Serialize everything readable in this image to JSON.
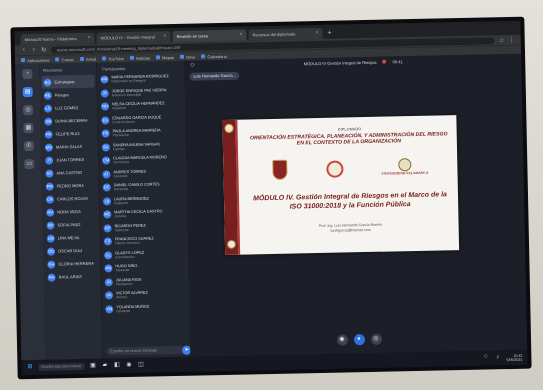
{
  "browser": {
    "tabs": [
      {
        "label": "Microsoft Teams - Plataforma"
      },
      {
        "label": "MÓDULO IV - Gestión Integral"
      },
      {
        "label": "Reunión en curso",
        "active": true
      },
      {
        "label": "Recursos del diplomado"
      }
    ],
    "new_tab": "+",
    "url": "teams.microsoft.com/_#/meeting/19:meeting_diplomado@thread.v2/0",
    "bookmarks": [
      "Aplicaciones",
      "Correo",
      "Gmail",
      "YouTube",
      "Noticias",
      "Mapas",
      "Drive",
      "Calendario"
    ]
  },
  "rail": {
    "icons": [
      "bell-icon",
      "chat-icon",
      "team-icon",
      "calendar-icon",
      "call-icon",
      "file-icon"
    ]
  },
  "chat_pane": {
    "header": "Reuniones",
    "items": [
      {
        "initials": "EG",
        "name": "Estrategias",
        "selected": true
      },
      {
        "initials": "RE",
        "name": "Riesgos"
      },
      {
        "initials": "LG",
        "name": "LUZ GOMEZ"
      },
      {
        "initials": "DB",
        "name": "DIANA BECERRA"
      },
      {
        "initials": "FR",
        "name": "FELIPE RUIZ"
      },
      {
        "initials": "MS",
        "name": "MARIA SALAS"
      },
      {
        "initials": "JT",
        "name": "JUAN TORRES"
      },
      {
        "initials": "AC",
        "name": "ANA CASTRO"
      },
      {
        "initials": "PM",
        "name": "PEDRO MORA"
      },
      {
        "initials": "CR",
        "name": "CARLOS ROJAS"
      },
      {
        "initials": "NV",
        "name": "NORA VEGA"
      },
      {
        "initials": "SP",
        "name": "SOFIA PAEZ"
      },
      {
        "initials": "LM",
        "name": "LINA MEJIA"
      },
      {
        "initials": "OD",
        "name": "OSCAR DIAZ"
      },
      {
        "initials": "GH",
        "name": "GLORIA HERRERA"
      },
      {
        "initials": "RA",
        "name": "RAUL ARIAS"
      }
    ]
  },
  "member_pane": {
    "header": "Participantes",
    "items": [
      {
        "initials": "MR",
        "name": "MARIA FERNANDA RODRIGUEZ",
        "sub": "Diplomado en Riesgos"
      },
      {
        "initials": "JP",
        "name": "JORGE ENRIQUE PAZ SIERRA",
        "sub": "Gobierno Municipal"
      },
      {
        "initials": "NH",
        "name": "NELSA CECILIA HERNANDEZ",
        "sub": "Asistente"
      },
      {
        "initials": "EG",
        "name": "EDUARDO GARCIA DUQUE",
        "sub": "Control Interno"
      },
      {
        "initials": "PB",
        "name": "PAOLA ANDREA BARRERA",
        "sub": "Planeación"
      },
      {
        "initials": "SV",
        "name": "SANDRA MILENA VARGAS",
        "sub": "Calidad"
      },
      {
        "initials": "CM",
        "name": "CLAUDIA MARCELA MORENO",
        "sub": "Secretaría"
      },
      {
        "initials": "AT",
        "name": "ANDRES TORRES",
        "sub": "Asistente"
      },
      {
        "initials": "DC",
        "name": "DANIEL CAMILO CORTES",
        "sub": "Hacienda"
      },
      {
        "initials": "LB",
        "name": "LAURA BERMUDEZ",
        "sub": "Asistente"
      },
      {
        "initials": "MC",
        "name": "MARTHA CECILIA CASTRO",
        "sub": "Jurídica"
      },
      {
        "initials": "RP",
        "name": "RICARDO PEREZ",
        "sub": "Sistemas"
      },
      {
        "initials": "FS",
        "name": "FRANCISCO SUAREZ",
        "sub": "Talento Humano"
      },
      {
        "initials": "GL",
        "name": "GLADYS LOPEZ",
        "sub": "Contratación"
      },
      {
        "initials": "HN",
        "name": "HUGO NIÑO",
        "sub": "Asistente"
      },
      {
        "initials": "JR",
        "name": "JULIANA RIOS",
        "sub": "Planeación"
      },
      {
        "initials": "VA",
        "name": "VICTOR ALVAREZ",
        "sub": "Archivo"
      },
      {
        "initials": "YM",
        "name": "YOLANDA MUÑOZ",
        "sub": "Asistente"
      }
    ],
    "compose_placeholder": "Escribe un nuevo mensaje",
    "send_icon": "send-icon"
  },
  "meeting": {
    "title": "MÓDULO IV Gestión Integral de Riesgos",
    "timer": "00:41",
    "presenter_chip": "Luis Hernando García...",
    "controls": [
      "mic-icon",
      "camera-icon",
      "share-icon"
    ]
  },
  "slide": {
    "kicker": "DIPLOMADO",
    "title": "ORIENTACIÓN ESTRATÉGICA, PLANEACIÓN, Y ADMINISTRACIÓN DEL RIESGO EN EL CONTEXTO DE LA ORGANIZACIÓN",
    "univ_name": "UNIVERSIDAD SALAMANCA",
    "module": "MÓDULO IV. Gestión Integral de Riesgos en el Marco de la ISO 31000:2018 y la Función Pública",
    "author": "Prof. Ing. Luis Hernando García Barreto",
    "email": "luishgarcia@hotmail.com",
    "colors": {
      "accent": "#7b2020",
      "bar": "#7a1f1f"
    }
  },
  "taskbar": {
    "search": "Escribe aquí para buscar",
    "clock_time": "10:42",
    "clock_date": "5/05/2021"
  }
}
